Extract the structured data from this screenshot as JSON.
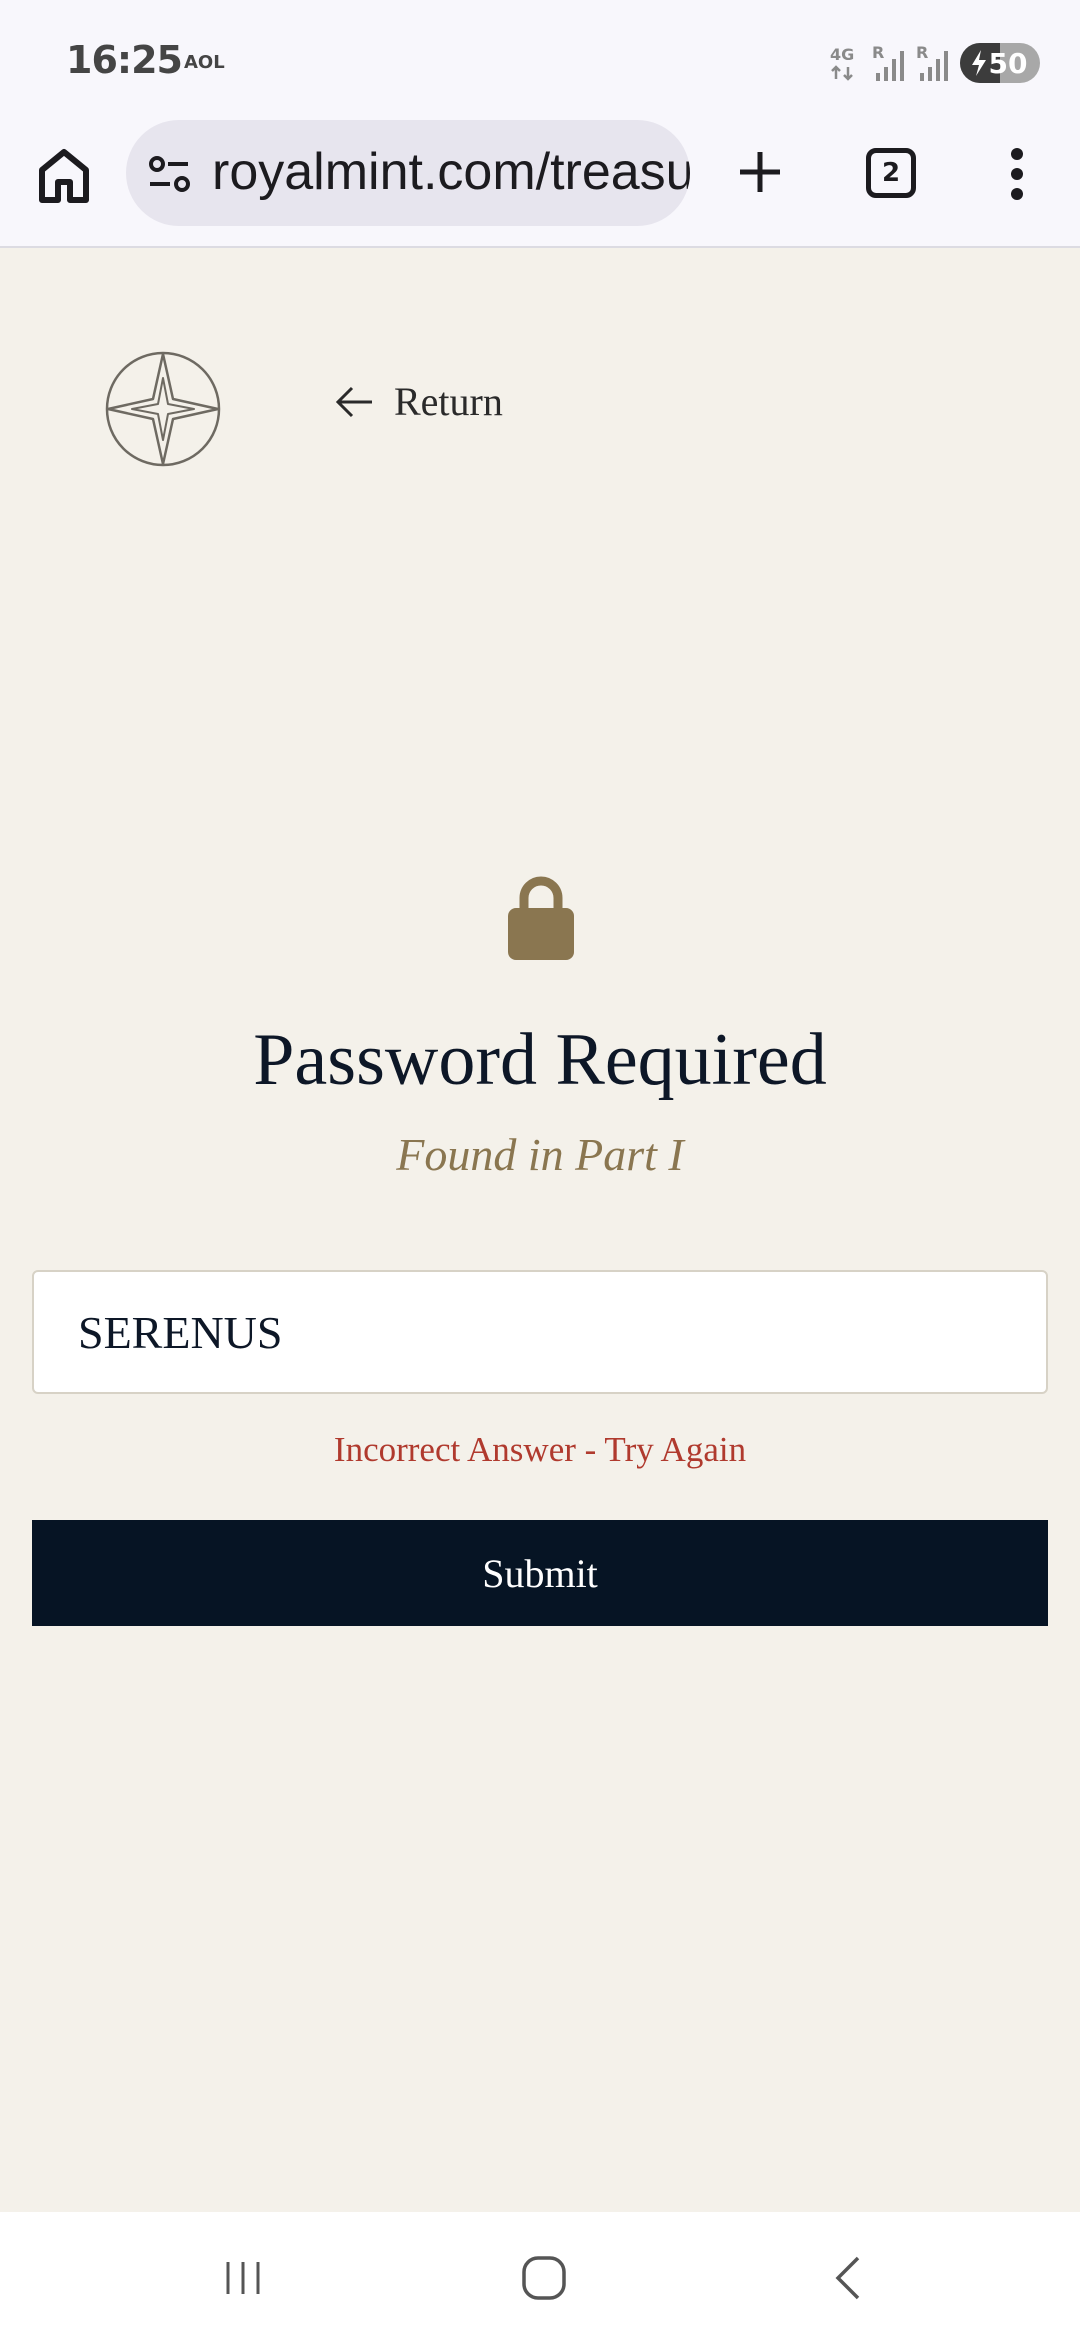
{
  "status_bar": {
    "time": "16:25",
    "carrier": "AOL",
    "network_type": "4G",
    "roaming_label_1": "R",
    "roaming_label_2": "R",
    "battery_level": "50"
  },
  "browser": {
    "url": "royalmint.com/treasure",
    "tab_count": "2",
    "icons": [
      "home-icon",
      "tune-icon",
      "plus-icon",
      "tab-switcher-icon",
      "more-vert-icon"
    ]
  },
  "page": {
    "return_label": "Return",
    "title": "Password Required",
    "subtitle": "Found in Part I",
    "password_value": "SERENUS",
    "error_message": "Incorrect Answer - Try Again",
    "submit_label": "Submit"
  },
  "colors": {
    "background": "#f4f1ea",
    "gold_accent": "#8a7650",
    "navy": "#061424",
    "error_red": "#b03a2e"
  },
  "nav_bar": {
    "icons": [
      "recent-apps-icon",
      "home-circle-icon",
      "back-icon"
    ]
  }
}
